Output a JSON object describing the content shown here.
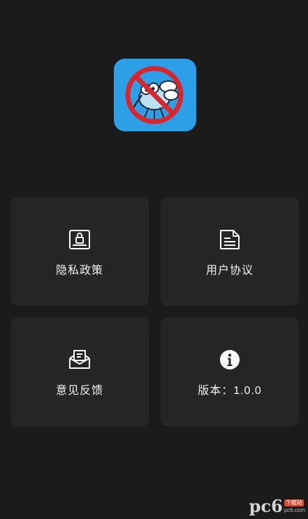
{
  "app": {
    "icon": "no-mosquito-app-icon"
  },
  "menu": {
    "privacy": {
      "label": "隐私政策",
      "icon": "lock-document-icon"
    },
    "terms": {
      "label": "用户协议",
      "icon": "document-icon"
    },
    "feedback": {
      "label": "意见反馈",
      "icon": "mail-icon"
    },
    "version": {
      "label": "版本：1.0.0",
      "icon": "info-icon"
    }
  },
  "watermark": {
    "brand": "pc6",
    "badge": "下载站",
    "domain": "pc6.com"
  },
  "colors": {
    "background": "#1b1b1b",
    "card": "#262626",
    "text": "#f2f2f2",
    "icon_bg": "#2d9fe8",
    "prohibit_red": "#d8262c"
  }
}
